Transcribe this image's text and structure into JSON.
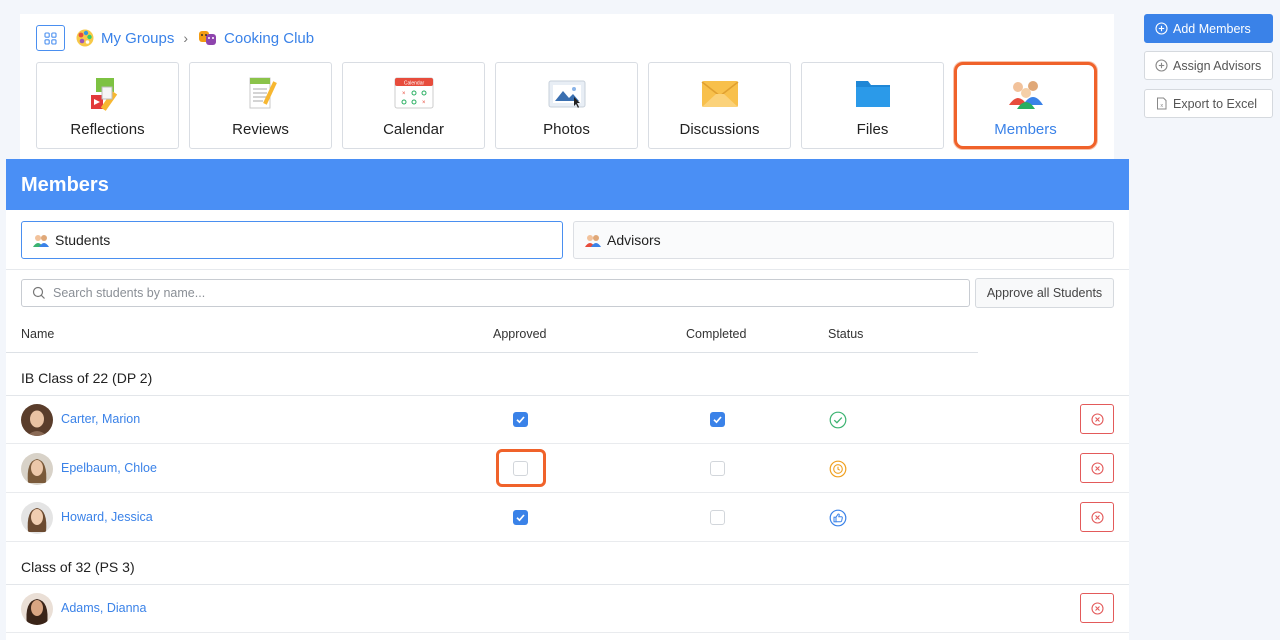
{
  "breadcrumb": {
    "root": "My Groups",
    "current": "Cooking Club"
  },
  "tiles": [
    {
      "label": "Reflections",
      "icon": "reflections-icon"
    },
    {
      "label": "Reviews",
      "icon": "reviews-icon"
    },
    {
      "label": "Calendar",
      "icon": "calendar-icon"
    },
    {
      "label": "Photos",
      "icon": "photos-icon"
    },
    {
      "label": "Discussions",
      "icon": "discussions-icon"
    },
    {
      "label": "Files",
      "icon": "files-icon"
    },
    {
      "label": "Members",
      "icon": "members-icon",
      "active": true
    }
  ],
  "calendar_icon_text": "Calendar",
  "actions": {
    "add_members": "Add Members",
    "assign_advisors": "Assign Advisors",
    "export_excel": "Export to Excel"
  },
  "members": {
    "title": "Members",
    "tabs": {
      "students": "Students",
      "advisors": "Advisors"
    },
    "search_placeholder": "Search students by name...",
    "approve_all": "Approve all Students",
    "columns": {
      "name": "Name",
      "approved": "Approved",
      "completed": "Completed",
      "status": "Status"
    },
    "groups": [
      {
        "title": "IB Class of 22 (DP 2)",
        "rows": [
          {
            "name": "Carter, Marion",
            "approved": true,
            "completed": true,
            "status": "check-circle-icon"
          },
          {
            "name": "Epelbaum, Chloe",
            "approved": false,
            "completed": false,
            "status": "clock-circle-icon"
          },
          {
            "name": "Howard, Jessica",
            "approved": true,
            "completed": false,
            "status": "thumbs-up-circle-icon"
          }
        ]
      },
      {
        "title": "Class of 32 (PS 3)",
        "rows": [
          {
            "name": "Adams, Dianna"
          }
        ]
      }
    ]
  },
  "colors": {
    "accent": "#3a82e8",
    "header": "#4a8ff5",
    "highlight": "#f0622a",
    "danger": "#e35a5a",
    "success": "#3cb371",
    "pending": "#f0a020"
  }
}
